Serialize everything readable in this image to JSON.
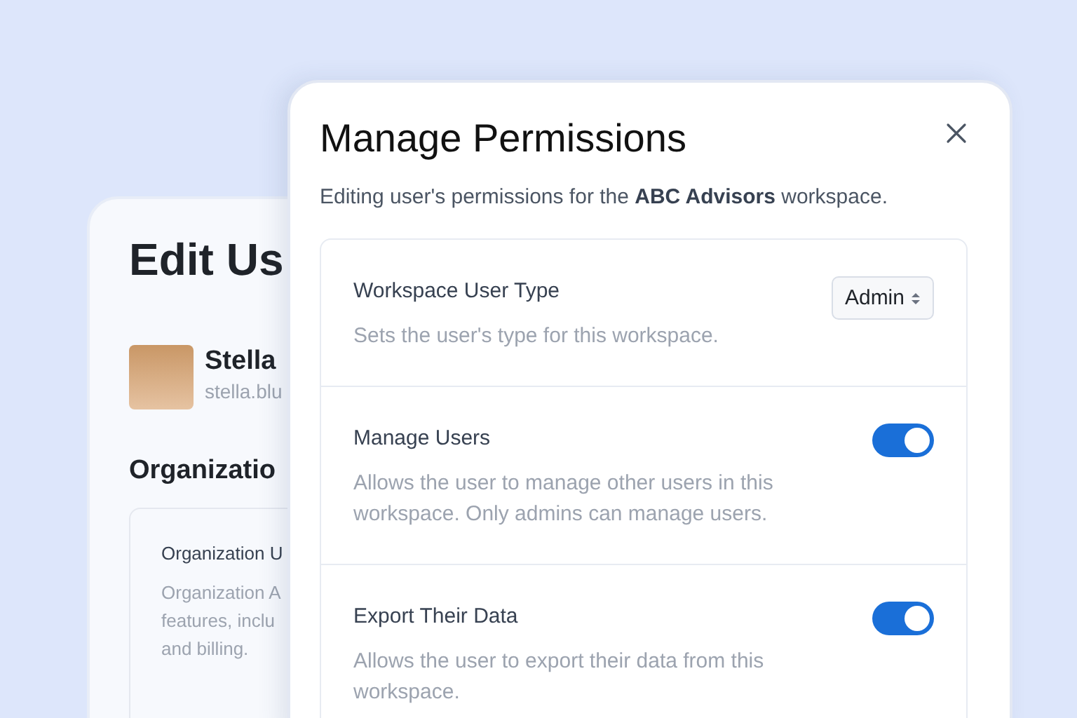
{
  "back_panel": {
    "title": "Edit Us",
    "user": {
      "name": "Stella",
      "email": "stella.blu"
    },
    "section_title": "Organizatio",
    "setting": {
      "label": "Organization U",
      "description_lines": [
        "Organization A",
        "features, inclu",
        "and billing."
      ]
    }
  },
  "dialog": {
    "title": "Manage Permissions",
    "subtitle": "Editing user's permissions for the **ABC Advisors** workspace.",
    "settings": [
      {
        "kind": "select",
        "label": "Workspace User Type",
        "description": "Sets the user's type for this workspace.",
        "value": "Admin"
      },
      {
        "kind": "toggle",
        "label": "Manage Users",
        "description": "Allows the user to manage other users in this workspace. Only admins can manage users.",
        "on": true
      },
      {
        "kind": "toggle",
        "label": "Export Their Data",
        "description": "Allows the user to export their data from this workspace.",
        "on": true
      }
    ]
  }
}
